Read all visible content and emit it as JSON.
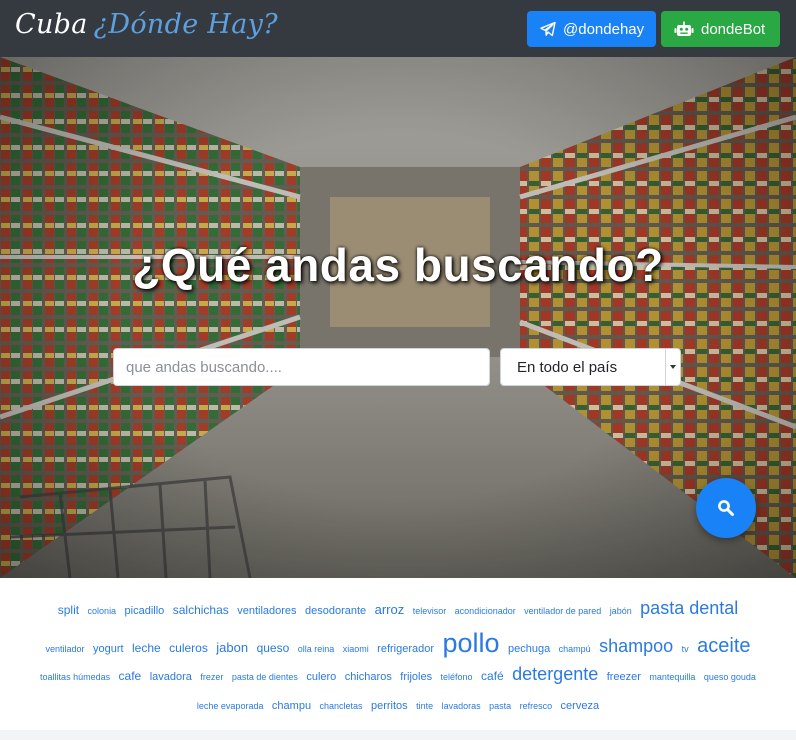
{
  "brand": {
    "part1": "Cuba",
    "part2": "¿Dónde Hay?"
  },
  "nav": {
    "telegram_label": "@dondehay",
    "bot_label": "dondeBot"
  },
  "hero": {
    "title": "¿Qué andas buscando?",
    "search_placeholder": "que andas buscando....",
    "region_value": "En todo el país"
  },
  "tags": [
    [
      {
        "t": "split",
        "s": 3
      },
      {
        "t": "colonia",
        "s": 1
      },
      {
        "t": "picadillo",
        "s": 2
      },
      {
        "t": "salchichas",
        "s": 3
      },
      {
        "t": "ventiladores",
        "s": 2
      },
      {
        "t": "desodorante",
        "s": 2
      },
      {
        "t": "arroz",
        "s": 4
      },
      {
        "t": "televisor",
        "s": 1
      },
      {
        "t": "acondicionador",
        "s": 1
      },
      {
        "t": "ventilador de pared",
        "s": 1
      },
      {
        "t": "jabón",
        "s": 1
      },
      {
        "t": "pasta dental",
        "s": 5
      }
    ],
    [
      {
        "t": "ventilador",
        "s": 1
      },
      {
        "t": "yogurt",
        "s": 2
      },
      {
        "t": "leche",
        "s": 3
      },
      {
        "t": "culeros",
        "s": 3
      },
      {
        "t": "jabon",
        "s": 4
      },
      {
        "t": "queso",
        "s": 3
      },
      {
        "t": "olla reina",
        "s": 1
      },
      {
        "t": "xiaomi",
        "s": 1
      },
      {
        "t": "refrigerador",
        "s": 2
      },
      {
        "t": "pollo",
        "s": 7
      },
      {
        "t": "pechuga",
        "s": 2
      },
      {
        "t": "champú",
        "s": 1
      },
      {
        "t": "shampoo",
        "s": 5
      },
      {
        "t": "tv",
        "s": 1
      },
      {
        "t": "aceite",
        "s": 6
      }
    ],
    [
      {
        "t": "toallitas húmedas",
        "s": 1
      },
      {
        "t": "cafe",
        "s": 3
      },
      {
        "t": "lavadora",
        "s": 2
      },
      {
        "t": "frezer",
        "s": 1
      },
      {
        "t": "pasta de dientes",
        "s": 1
      },
      {
        "t": "culero",
        "s": 2
      },
      {
        "t": "chicharos",
        "s": 2
      },
      {
        "t": "frijoles",
        "s": 2
      },
      {
        "t": "teléfono",
        "s": 1
      },
      {
        "t": "café",
        "s": 3
      },
      {
        "t": "detergente",
        "s": 5
      },
      {
        "t": "freezer",
        "s": 2
      },
      {
        "t": "mantequilla",
        "s": 1
      },
      {
        "t": "queso gouda",
        "s": 1
      }
    ],
    [
      {
        "t": "leche evaporada",
        "s": 1
      },
      {
        "t": "champu",
        "s": 2
      },
      {
        "t": "chancletas",
        "s": 1
      },
      {
        "t": "perritos",
        "s": 2
      },
      {
        "t": "tinte",
        "s": 1
      },
      {
        "t": "lavadoras",
        "s": 1
      },
      {
        "t": "pasta",
        "s": 1
      },
      {
        "t": "refresco",
        "s": 1
      },
      {
        "t": "cerveza",
        "s": 2
      }
    ]
  ]
}
